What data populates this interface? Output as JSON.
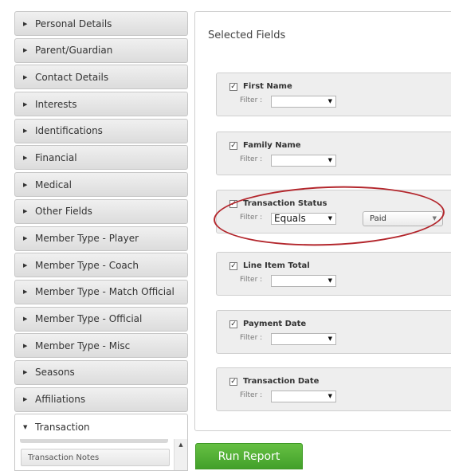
{
  "sidebar": {
    "items": [
      {
        "label": "Personal Details"
      },
      {
        "label": "Parent/Guardian"
      },
      {
        "label": "Contact Details"
      },
      {
        "label": "Interests"
      },
      {
        "label": "Identifications"
      },
      {
        "label": "Financial"
      },
      {
        "label": "Medical"
      },
      {
        "label": "Other Fields"
      },
      {
        "label": "Member Type - Player"
      },
      {
        "label": "Member Type - Coach"
      },
      {
        "label": "Member Type - Match Official"
      },
      {
        "label": "Member Type - Official"
      },
      {
        "label": "Member Type - Misc"
      },
      {
        "label": "Seasons"
      },
      {
        "label": "Affiliations"
      }
    ],
    "open_section": {
      "label": "Transaction",
      "sub_items": [
        {
          "label": "Transaction Notes"
        }
      ]
    }
  },
  "main": {
    "title": "Selected Fields",
    "filter_label": "Filter :",
    "fields": [
      {
        "name": "First Name",
        "checked": true,
        "filter_value": ""
      },
      {
        "name": "Family Name",
        "checked": true,
        "filter_value": ""
      },
      {
        "name": "Transaction Status",
        "checked": true,
        "filter_value": "Equals",
        "filter_option": "Paid"
      },
      {
        "name": "Line Item Total",
        "checked": true,
        "filter_value": ""
      },
      {
        "name": "Payment Date",
        "checked": true,
        "filter_value": ""
      },
      {
        "name": "Transaction Date",
        "checked": true,
        "filter_value": ""
      }
    ]
  },
  "actions": {
    "run_report_label": "Run Report"
  },
  "colors": {
    "run_button": "#4caf33",
    "highlight_ellipse": "#b3262c",
    "field_box_bg": "#eeeeee"
  },
  "icons": {
    "collapsed": "triangle-right-icon",
    "expanded": "triangle-down-icon",
    "select": "caret-down-icon",
    "checkbox": "checkbox-checked-icon"
  }
}
